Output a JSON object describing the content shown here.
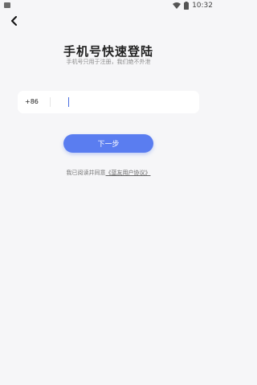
{
  "status_bar": {
    "time": "10:32",
    "left_icon": "notification-square-icon",
    "wifi_icon": "wifi-icon",
    "battery_icon": "battery-icon"
  },
  "nav": {
    "back_icon": "chevron-left-icon"
  },
  "header": {
    "title": "手机号快速登陆",
    "subtitle": "手机号只用于注册，我们绝不外泄"
  },
  "phone": {
    "country_code": "+86",
    "value": "",
    "placeholder": ""
  },
  "actions": {
    "next_label": "下一步"
  },
  "agreement": {
    "prefix": "我已阅读并同意",
    "link": "《蓝友用户协议》"
  },
  "colors": {
    "primary": "#5a7df0",
    "background": "#f6f6f8"
  }
}
